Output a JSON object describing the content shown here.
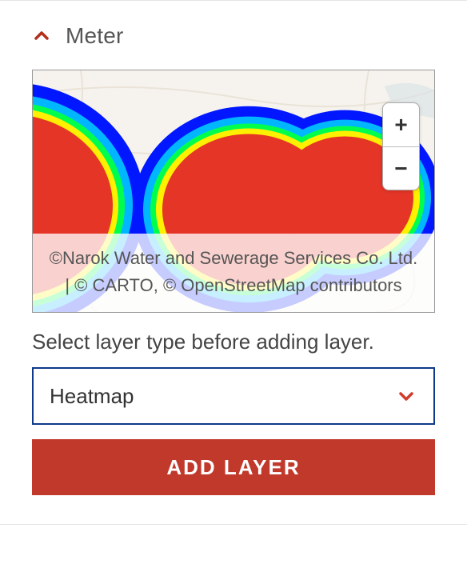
{
  "section": {
    "title": "Meter"
  },
  "map": {
    "attribution": "©Narok Water and Sewerage Services Co. Ltd. | © CARTO, © OpenStreetMap contributors",
    "zoom_in_symbol": "+",
    "zoom_out_symbol": "−"
  },
  "layer_picker": {
    "instruction": "Select layer type before adding layer.",
    "selected": "Heatmap"
  },
  "actions": {
    "add_layer_label": "ADD LAYER"
  }
}
